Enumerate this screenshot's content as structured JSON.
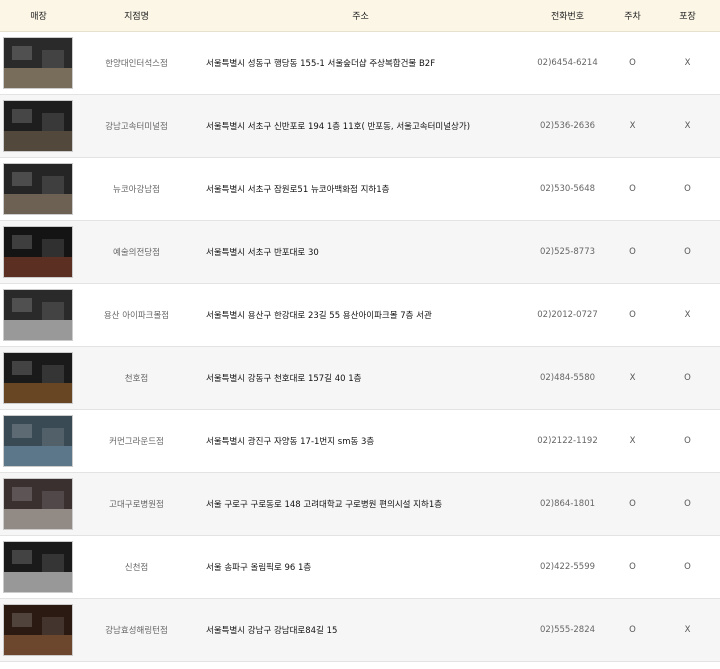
{
  "headers": {
    "store": "매장",
    "branch": "지점명",
    "address": "주소",
    "phone": "전화번호",
    "parking": "주차",
    "packing": "포장"
  },
  "rows": [
    {
      "branch": "한양대인터석스점",
      "address": "서울특별시 성동구 행당동 155-1 서울숲더샵 주상복합건물 B2F",
      "phone": "02)6454-6214",
      "parking": "O",
      "packing": "X"
    },
    {
      "branch": "강남고속터미널점",
      "address": "서울특별시 서초구 신반포로 194 1층 11호( 반포동, 서울고속터미널상가)",
      "phone": "02)536-2636",
      "parking": "X",
      "packing": "X"
    },
    {
      "branch": "뉴코아강남점",
      "address": "서울특별시 서초구 잠원로51 뉴코아백화점 지하1층",
      "phone": "02)530-5648",
      "parking": "O",
      "packing": "O"
    },
    {
      "branch": "예술의전당점",
      "address": "서울특별시 서초구 반포대로 30",
      "phone": "02)525-8773",
      "parking": "O",
      "packing": "O"
    },
    {
      "branch": "용산 아이파크몰점",
      "address": "서울특별시 용산구 한강대로 23길 55 용산아이파크몰 7층 서관",
      "phone": "02)2012-0727",
      "parking": "O",
      "packing": "X"
    },
    {
      "branch": "천호점",
      "address": "서울특별시 강동구 천호대로 157길 40 1층",
      "phone": "02)484-5580",
      "parking": "X",
      "packing": "O"
    },
    {
      "branch": "커먼그라운드점",
      "address": "서울특별시 광진구 자양동 17-1번지 sm동 3층",
      "phone": "02)2122-1192",
      "parking": "X",
      "packing": "O"
    },
    {
      "branch": "고대구로병원점",
      "address": "서울 구로구 구로동로 148 고려대학교 구로병원 편의시설 지하1층",
      "phone": "02)864-1801",
      "parking": "O",
      "packing": "O"
    },
    {
      "branch": "신천점",
      "address": "서울 송파구 올림픽로 96 1층",
      "phone": "02)422-5599",
      "parking": "O",
      "packing": "O"
    },
    {
      "branch": "강남효성해링턴점",
      "address": "서울특별시 강남구 강남대로84길 15",
      "phone": "02)555-2824",
      "parking": "O",
      "packing": "X"
    }
  ],
  "thumb_colors": [
    [
      "#2a2a2a",
      "#9a8a70"
    ],
    [
      "#1e1e1e",
      "#6a5a48"
    ],
    [
      "#252525",
      "#8a7a66"
    ],
    [
      "#141414",
      "#7a3a2a"
    ],
    [
      "#2a2a2a",
      "#c9c9c9"
    ],
    [
      "#1a1a1a",
      "#8a5a2a"
    ],
    [
      "#3a4a55",
      "#6a8aa0"
    ],
    [
      "#3a3030",
      "#b8b0a8"
    ],
    [
      "#1a1a1a",
      "#cfcfcf"
    ],
    [
      "#2a1a12",
      "#8a5a3a"
    ]
  ]
}
